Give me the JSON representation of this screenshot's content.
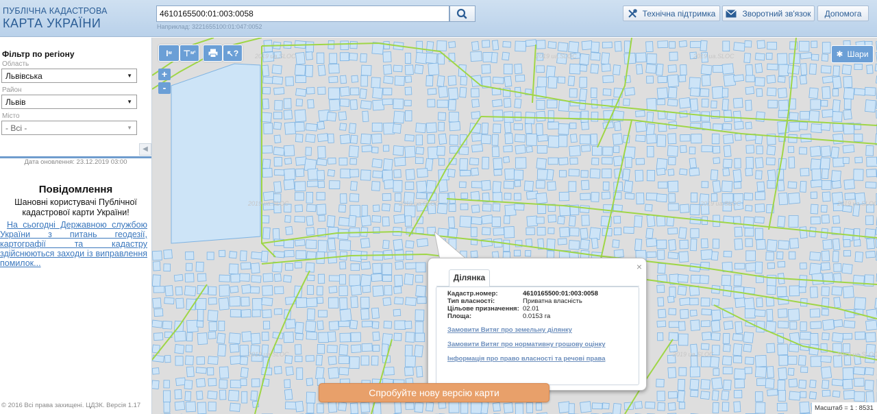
{
  "header": {
    "logo_line1": "ПУБЛІЧНА КАДАСТРОВА",
    "logo_line2": "КАРТА УКРАЇНИ",
    "search_value": "4610165500:01:003:0058",
    "search_hint": "Наприклад: 3221655100:01:047:0052",
    "support_label": "Технічна підтримка",
    "feedback_label": "Зворотний зв'язок",
    "help_label": "Допомога"
  },
  "sidebar": {
    "filter_title": "Фільтр по регіону",
    "region_label": "Область",
    "region_value": "Львівська",
    "district_label": "Район",
    "district_value": "Львів",
    "city_label": "Місто",
    "city_value": "- Всі -",
    "update_date": "Дата оновлення: 23.12.2019 03:00",
    "news_title": "Повідомлення",
    "news_greeting": "Шановні користувачі Публічної кадастрової карти України!",
    "news_link": "На сьогодні Державною службою України з питань геодезії, картографії та кадастру здійснюються заходи із виправлення помилок...",
    "footer": "© 2016 Всі права захищені. ЦДЗК. Версія 1.17"
  },
  "map": {
    "tool_measure_length": "м",
    "tool_measure_area": "м²",
    "zoom_in": "+",
    "zoom_out": "-",
    "layers_label": "Шари",
    "watermark": "2019 ua.SLOC",
    "new_version_label": "Спробуйте нову версію карти",
    "scale_label": "Масштаб = 1 : 8531"
  },
  "popup": {
    "tab_label": "Ділянка",
    "rows": [
      {
        "label": "Кадастр.номер:",
        "value": "4610165500:01:003:0058"
      },
      {
        "label": "Тип власності:",
        "value": "Приватна власність"
      },
      {
        "label": "Цільове призначення:",
        "value": "02.01"
      },
      {
        "label": "Площа:",
        "value": "0.0153 га"
      }
    ],
    "links": [
      "Замовити Витяг про земельну ділянку",
      "Замовити Витяг про нормативну грошову оцінку",
      "Інформація про право власності та речові права"
    ],
    "close": "×"
  },
  "colors": {
    "accent": "#6b9fd6",
    "parcel_fill": "#cde4f7",
    "parcel_stroke": "#7db3e3",
    "road_line": "#9fd646",
    "map_bg": "#dedede",
    "banner": "#e8a06a"
  }
}
